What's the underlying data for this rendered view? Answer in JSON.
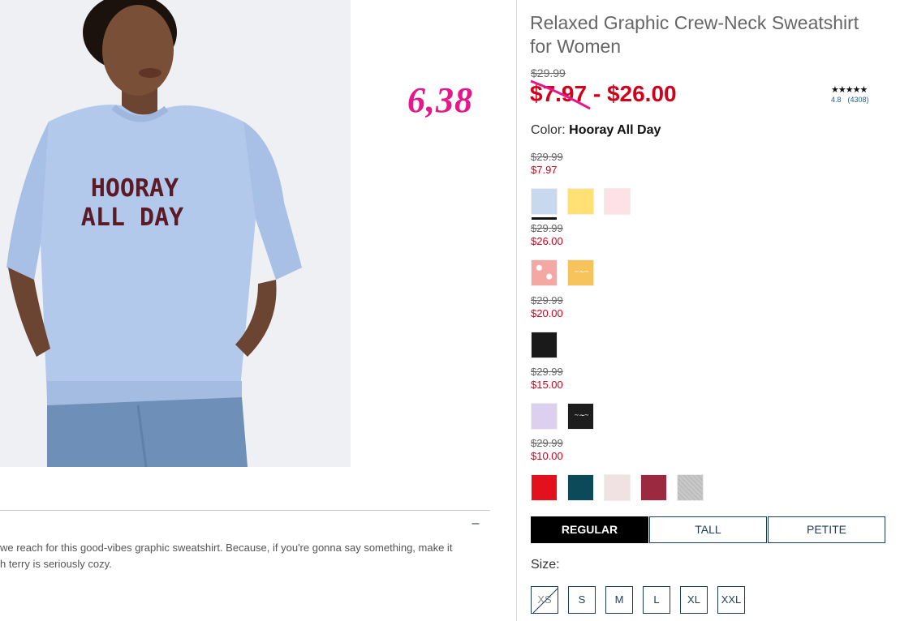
{
  "product": {
    "title": "Relaxed Graphic Crew-Neck Sweatshirt for Women",
    "original_price": "$29.99",
    "price_low": "$7.97",
    "price_separator": " - ",
    "price_high": "$26.00",
    "rating_stars": "★★★★★",
    "rating_value": "4.8",
    "rating_count": "(4308)",
    "image_graphic_text_line1": "HOORAY",
    "image_graphic_text_line2": "ALL DAY"
  },
  "annotation": {
    "text": "6,38"
  },
  "color": {
    "label": "Color:",
    "selected_name": "Hooray All Day"
  },
  "price_groups": [
    {
      "old": "$29.99",
      "new": "$7.97",
      "swatches": [
        {
          "color": "#c7d8ef",
          "selected": true
        },
        {
          "color": "#ffe074"
        },
        {
          "color": "#fde1e6"
        }
      ]
    },
    {
      "old": "$29.99",
      "new": "$26.00",
      "swatches": [
        {
          "color": "#f4a7a3",
          "pattern": "floral"
        },
        {
          "color": "#f7c45c",
          "pattern": "script"
        }
      ]
    },
    {
      "old": "$29.99",
      "new": "$20.00",
      "swatches": [
        {
          "color": "#1a1a1a"
        }
      ]
    },
    {
      "old": "$29.99",
      "new": "$15.00",
      "swatches": [
        {
          "color": "#dccff0"
        },
        {
          "color": "#1d1d1d",
          "pattern": "script"
        }
      ]
    },
    {
      "old": "$29.99",
      "new": "$10.00",
      "swatches": [
        {
          "color": "#e3101e"
        },
        {
          "color": "#0c4a5a"
        },
        {
          "color": "#f0e2e2"
        },
        {
          "color": "#9b2a40"
        },
        {
          "color": "#c9c9c9",
          "pattern": "heather"
        }
      ]
    }
  ],
  "fit": {
    "options": [
      "REGULAR",
      "TALL",
      "PETITE"
    ],
    "selected": "REGULAR"
  },
  "size": {
    "label": "Size:",
    "options": [
      "XS",
      "S",
      "M",
      "L",
      "XL",
      "XXL"
    ],
    "unavailable": [
      "XS"
    ]
  },
  "description": {
    "text": "we reach for this good-vibes graphic sweatshirt. Because, if you're gonna say something, make it\nh terry is seriously cozy.",
    "collapse_icon": "minus-icon"
  },
  "colors": {
    "sale_red": "#d0021b",
    "navy": "#1d3b5a",
    "annotation_pink": "#e6168b"
  }
}
